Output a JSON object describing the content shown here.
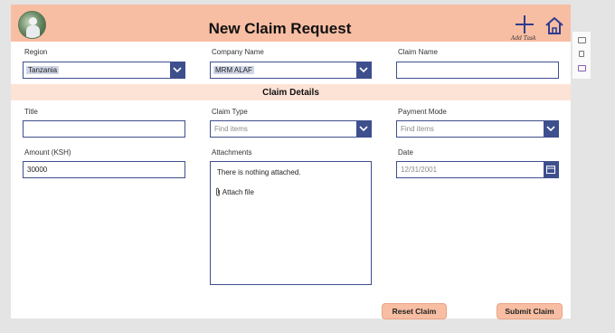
{
  "header": {
    "title": "New Claim Request",
    "add_task_label": "Add Task"
  },
  "top_fields": {
    "region": {
      "label": "Region",
      "value": "Tanzania"
    },
    "company": {
      "label": "Company Name",
      "value": "MRM ALAF"
    },
    "claim_name": {
      "label": "Claim Name",
      "value": ""
    }
  },
  "section": {
    "title": "Claim Details"
  },
  "details": {
    "title": {
      "label": "Title",
      "value": ""
    },
    "claim_type": {
      "label": "Claim Type",
      "placeholder": "Find items"
    },
    "payment_mode": {
      "label": "Payment Mode",
      "placeholder": "Find items"
    },
    "amount": {
      "label": "Amount (KSH)",
      "value": "30000"
    },
    "attachments": {
      "label": "Attachments",
      "empty_text": "There is nothing attached.",
      "attach_label": "Attach file"
    },
    "date": {
      "label": "Date",
      "value": "12/31/2001"
    }
  },
  "buttons": {
    "reset": "Reset Claim",
    "submit": "Submit Claim"
  },
  "colors": {
    "header_bg": "#f8bea3",
    "section_bg": "#fde3d6",
    "accent": "#3e4f8e",
    "button_bg": "#f8bea3"
  },
  "icons": [
    "avatar",
    "plus-icon",
    "home-icon",
    "chevron-down-icon",
    "calendar-icon",
    "paperclip-icon"
  ]
}
